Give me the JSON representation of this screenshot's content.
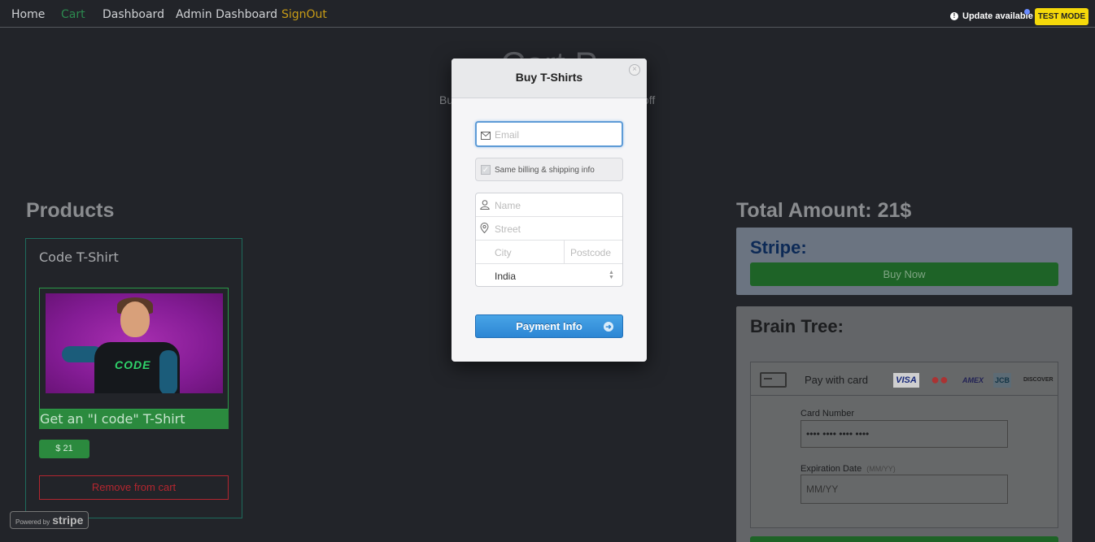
{
  "nav": {
    "home": "Home",
    "cart": "Cart",
    "dashboard": "Dashboard",
    "admin_dashboard": "Admin Dashboard",
    "signout": "SignOut"
  },
  "status": {
    "update": "Update available",
    "test_mode": "TEST MODE"
  },
  "hero": {
    "title": "Cart P",
    "subtitle_left": "Bu",
    "subtitle_right": "off"
  },
  "products": {
    "heading": "Products",
    "items": [
      {
        "title": "Code T-Shirt",
        "image_text": "CODE",
        "description": "Get an \"I code\" T-Shirt",
        "price": "$ 21",
        "remove_label": "Remove from cart"
      }
    ]
  },
  "powered_by": {
    "prefix": "Powered by",
    "brand": "stripe"
  },
  "checkout": {
    "total": "Total Amount: 21$",
    "stripe_label": "Stripe:",
    "buy_now": "Buy Now",
    "braintree_label": "Brain Tree:",
    "pay_with_card": "Pay with card",
    "card_brands": [
      "VISA",
      "●●",
      "AMEX",
      "JCB",
      "DISCOVER"
    ],
    "card_number_label": "Card Number",
    "card_number_placeholder": "•••• •••• •••• ••••",
    "expiration_label": "Expiration Date",
    "expiration_hint": "(MM/YY)",
    "expiration_placeholder": "MM/YY"
  },
  "modal": {
    "title": "Buy T-Shirts",
    "close": "×",
    "email_placeholder": "Email",
    "same_billing": "Same billing & shipping info",
    "name_placeholder": "Name",
    "street_placeholder": "Street",
    "city_placeholder": "City",
    "postcode_placeholder": "Postcode",
    "country": "India",
    "payment_button": "Payment Info"
  },
  "colors": {
    "accent_green": "#2b8a3e",
    "stripe_blue": "#2c86d4",
    "test_mode_yellow": "#f5d90a",
    "danger_red": "#b4262f"
  }
}
